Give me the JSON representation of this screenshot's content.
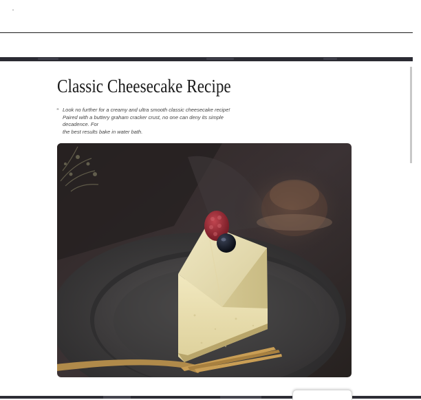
{
  "recipe": {
    "title": "Classic Cheesecake Recipe",
    "intro_lines": [
      "Look no further for a creamy and ultra smooth classic cheesecake recipe!",
      "Paired with a buttery graham cracker crust, no one can deny its simple decadence. For",
      "the best results bake in water bath."
    ]
  },
  "hero_image": {
    "subject": "slice of cheesecake topped with a raspberry and a blueberry on a dark plate with a gold fork"
  },
  "colors": {
    "chrome_dark": "#2b2b33",
    "title_text": "#1a1a1a",
    "body_text": "#444444"
  }
}
